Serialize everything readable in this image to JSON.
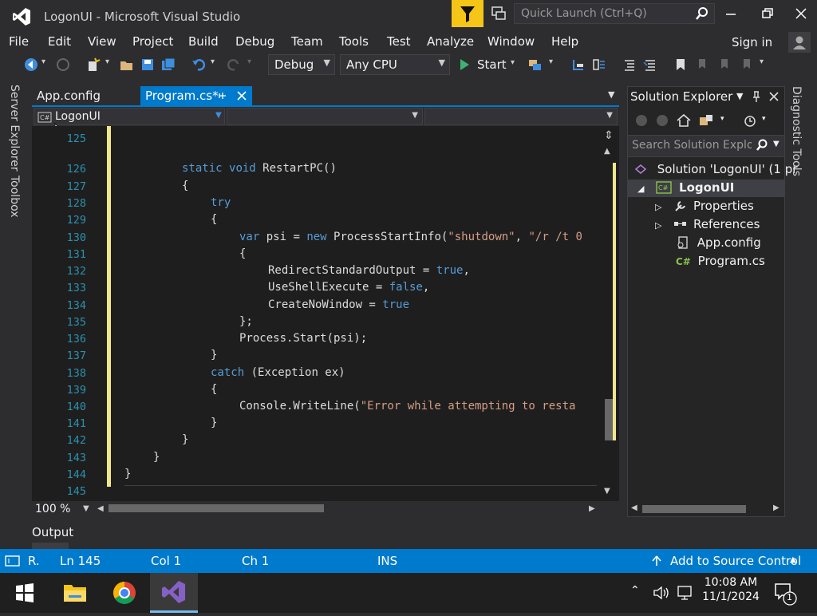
{
  "window": {
    "title": "LogonUI - Microsoft Visual Studio",
    "quick_launch_placeholder": "Quick Launch (Ctrl+Q)"
  },
  "menu": [
    "File",
    "Edit",
    "View",
    "Project",
    "Build",
    "Debug",
    "Team",
    "Tools",
    "Test",
    "Analyze",
    "Window",
    "Help"
  ],
  "sign_in": "Sign in",
  "toolbar": {
    "configuration": "Debug",
    "platform": "Any CPU",
    "start_label": "Start"
  },
  "side_tabs": [
    "Server Explorer",
    "Toolbox"
  ],
  "editor_tabs": [
    {
      "label": "App.config",
      "active": false
    },
    {
      "label": "Program.cs*",
      "active": true
    }
  ],
  "nav_project": "LogonUI",
  "code_lines": [
    {
      "n": "125",
      "text": ""
    },
    {
      "n": "126",
      "text": "static void RestartPC()"
    },
    {
      "n": "127",
      "text": "{"
    },
    {
      "n": "128",
      "text": "try"
    },
    {
      "n": "129",
      "text": "{"
    },
    {
      "n": "130",
      "text": "var psi = new ProcessStartInfo(\"shutdown\", \"/r /t 0"
    },
    {
      "n": "131",
      "text": "{"
    },
    {
      "n": "132",
      "text": "RedirectStandardOutput = true,"
    },
    {
      "n": "133",
      "text": "UseShellExecute = false,"
    },
    {
      "n": "134",
      "text": "CreateNoWindow = true"
    },
    {
      "n": "135",
      "text": "};"
    },
    {
      "n": "136",
      "text": "Process.Start(psi);"
    },
    {
      "n": "137",
      "text": "}"
    },
    {
      "n": "138",
      "text": "catch (Exception ex)"
    },
    {
      "n": "139",
      "text": "{"
    },
    {
      "n": "140",
      "text": "Console.WriteLine(\"Error while attempting to resta"
    },
    {
      "n": "141",
      "text": "}"
    },
    {
      "n": "142",
      "text": "}"
    },
    {
      "n": "143",
      "text": "}"
    },
    {
      "n": "144",
      "text": "}"
    },
    {
      "n": "145",
      "text": ""
    }
  ],
  "zoom": "100 %",
  "solution_explorer": {
    "title": "Solution Explorer",
    "search_placeholder": "Search Solution Explor",
    "items": [
      {
        "label": "Solution 'LogonUI' (1 pr",
        "icon": "solution-icon"
      },
      {
        "label": "LogonUI",
        "icon": "csharp-project-icon"
      },
      {
        "label": "Properties",
        "icon": "wrench-icon"
      },
      {
        "label": "References",
        "icon": "references-icon"
      },
      {
        "label": "App.config",
        "icon": "config-file-icon"
      },
      {
        "label": "Program.cs",
        "icon": "csharp-file-icon"
      }
    ]
  },
  "diagnostic_tools": "Diagnostic Tools",
  "output_label": "Output",
  "status": {
    "ready": "R.",
    "line": "Ln 145",
    "col": "Col 1",
    "ch": "Ch 1",
    "mode": "INS",
    "source_control": "Add to Source Control"
  },
  "taskbar": {
    "time": "10:08 AM",
    "date": "11/1/2024",
    "notification_count": "1"
  },
  "colors": {
    "accent": "#007acc",
    "filter_button": "#f5c518",
    "keyword": "#569cd6",
    "string": "#d69d85",
    "line_number": "#2b91af",
    "change_bar": "#f0e68c"
  }
}
